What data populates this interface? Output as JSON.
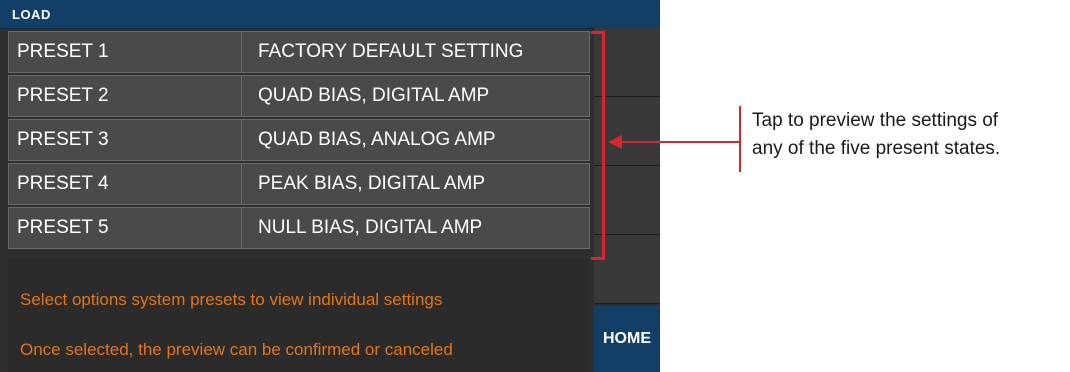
{
  "window": {
    "title": "LOAD"
  },
  "presets": [
    {
      "name": "PRESET 1",
      "description": "FACTORY DEFAULT SETTING"
    },
    {
      "name": "PRESET 2",
      "description": "QUAD BIAS, DIGITAL AMP"
    },
    {
      "name": "PRESET 3",
      "description": "QUAD BIAS, ANALOG AMP"
    },
    {
      "name": "PRESET 4",
      "description": "PEAK BIAS, DIGITAL AMP"
    },
    {
      "name": "PRESET 5",
      "description": "NULL BIAS, DIGITAL AMP"
    }
  ],
  "info": {
    "line1": "Select options system presets to view individual settings",
    "line2": "Once selected, the preview can be confirmed or canceled"
  },
  "home_button": {
    "label": "HOME"
  },
  "callout": {
    "line1": "Tap to preview the settings of",
    "line2": "any of the five present states."
  },
  "colors": {
    "title_bar": "#123f66",
    "accent_orange": "#e2761d",
    "annotation_red": "#d9262e"
  }
}
